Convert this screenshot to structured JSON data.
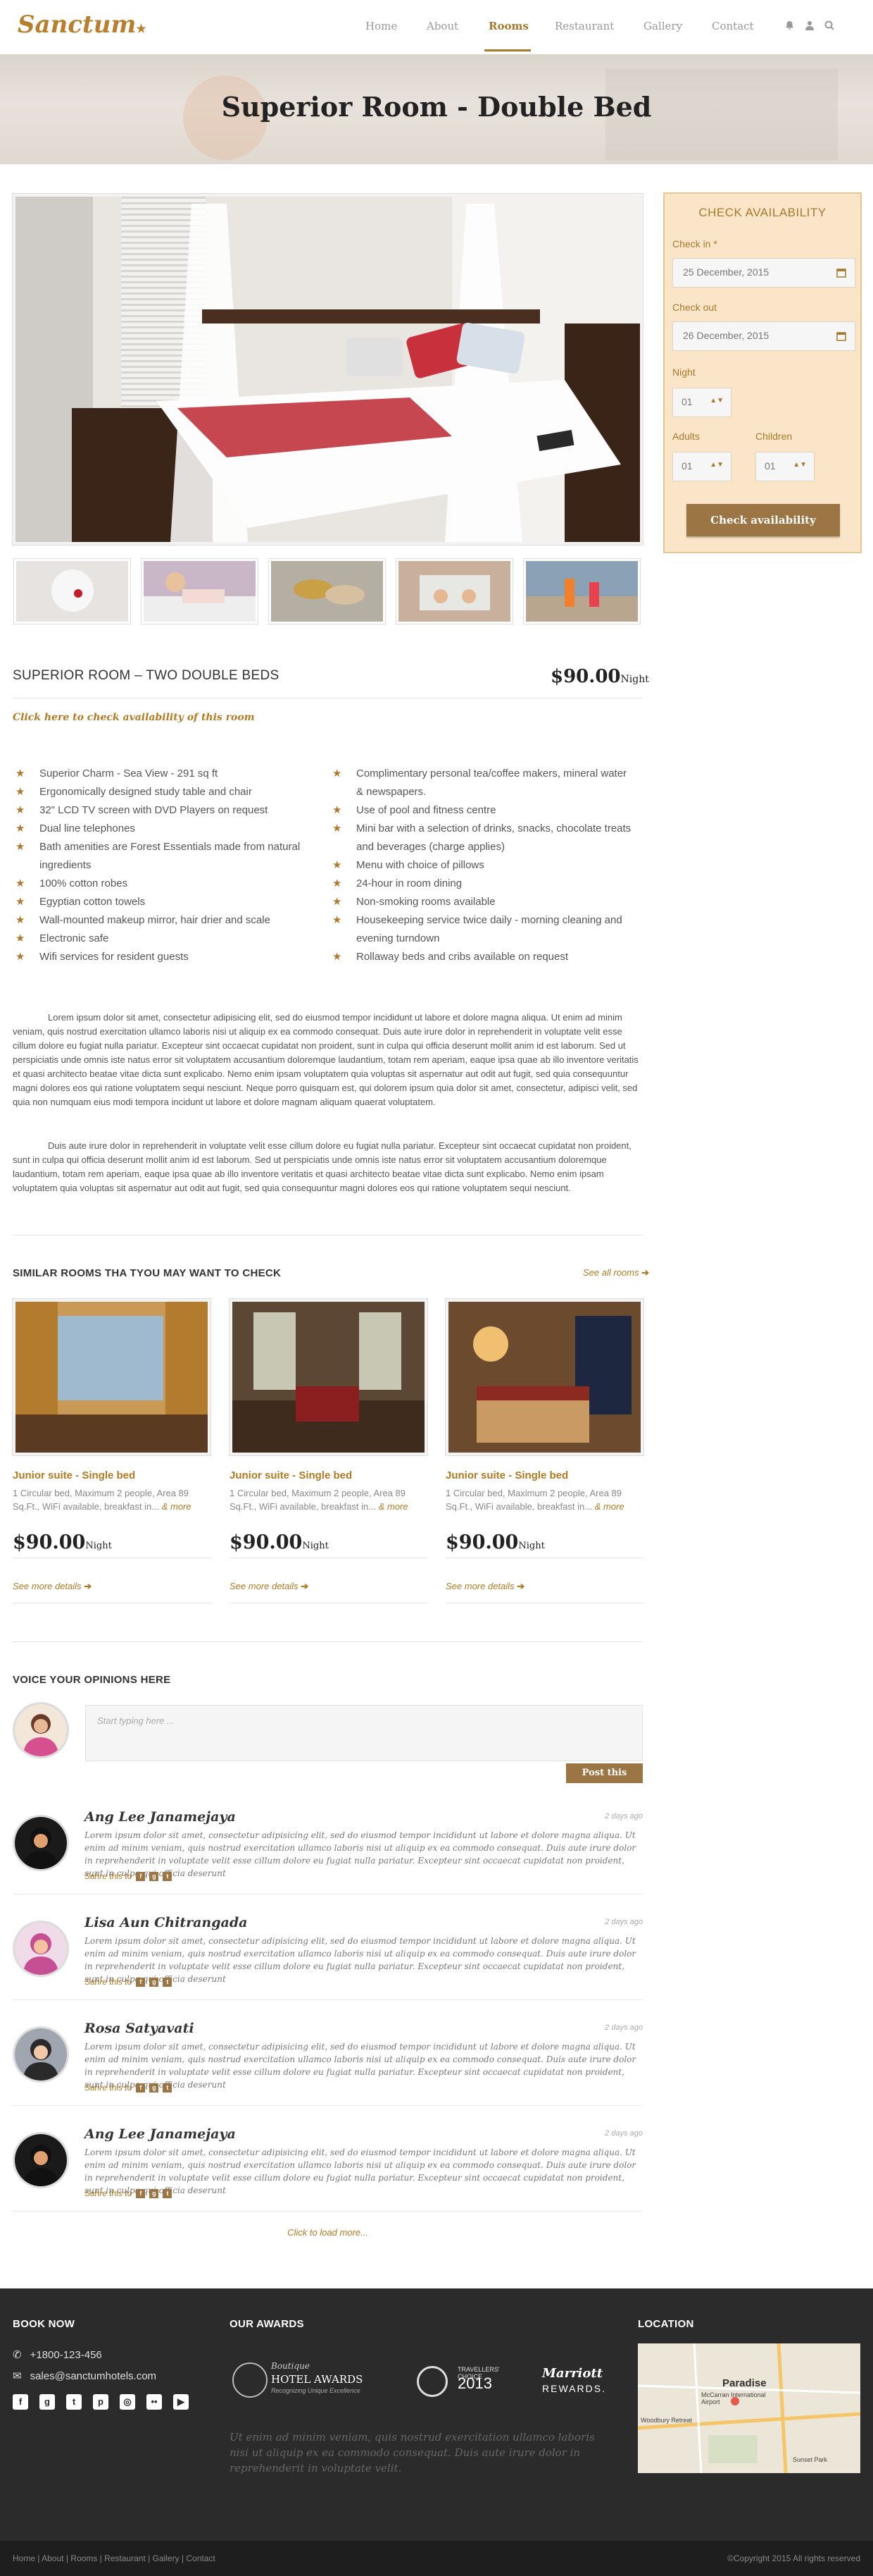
{
  "brand": {
    "logo": "Sanctum"
  },
  "nav": {
    "items": [
      "Home",
      "About",
      "Rooms",
      "Restaurant",
      "Gallery",
      "Contact"
    ],
    "active": "Rooms"
  },
  "hero": {
    "title": "Superior Room - Double Bed"
  },
  "booking": {
    "title": "CHECK AVAILABILITY",
    "checkin_label": "Check in *",
    "checkin_value": "25 December, 2015",
    "checkout_label": "Check out",
    "checkout_value": "26 December, 2015",
    "night_label": "Night",
    "night_value": "01",
    "adults_label": "Adults",
    "adults_value": "01",
    "children_label": "Children",
    "children_value": "01",
    "button": "Check availability"
  },
  "room": {
    "title": "SUPERIOR ROOM – TWO DOUBLE BEDS",
    "price": "$90.00",
    "price_unit": "Night",
    "check_link": "Click here to check availability of this room",
    "features_left": [
      "Superior Charm - Sea View - 291 sq ft",
      "Ergonomically designed study table and chair",
      "32\" LCD TV screen with DVD Players on request",
      "Dual line telephones",
      "Bath amenities are Forest Essentials made from natural",
      "ingredients",
      "100% cotton robes",
      "Egyptian cotton towels",
      "Wall-mounted makeup mirror, hair drier and scale",
      "Electronic safe",
      "Wifi services for resident guests"
    ],
    "features_right": [
      "Complimentary personal tea/coffee makers, mineral water",
      "& newspapers.",
      "Use of pool and fitness centre",
      "Mini bar with a selection of drinks, snacks, chocolate treats",
      "and beverages (charge applies)",
      "Menu with choice of pillows",
      "24-hour in room dining",
      "Non-smoking rooms available",
      "Housekeeping service twice daily - morning cleaning and",
      "evening turndown",
      "Rollaway beds and cribs available on request"
    ],
    "description_1": "Lorem ipsum dolor sit amet, consectetur adipisicing elit, sed do eiusmod tempor incididunt ut labore et dolore magna aliqua. Ut enim ad minim veniam, quis nostrud exercitation ullamco laboris nisi ut aliquip ex ea commodo consequat. Duis aute irure dolor in reprehenderit in voluptate velit esse cillum dolore eu fugiat nulla pariatur. Excepteur sint occaecat cupidatat non proident, sunt in culpa qui officia deserunt mollit anim id est laborum. Sed ut perspiciatis unde omnis iste natus error sit voluptatem accusantium doloremque laudantium, totam rem aperiam, eaque ipsa quae ab illo inventore veritatis et quasi architecto beatae vitae dicta sunt explicabo. Nemo enim ipsam voluptatem quia voluptas sit aspernatur aut odit aut fugit, sed quia consequuntur magni dolores eos qui ratione voluptatem sequi nesciunt. Neque porro quisquam est, qui dolorem ipsum quia dolor sit amet, consectetur, adipisci velit, sed quia non numquam eius modi tempora incidunt ut labore et dolore magnam aliquam quaerat voluptatem.",
    "description_2": "Duis aute irure dolor in reprehenderit in voluptate velit esse cillum dolore eu fugiat nulla pariatur. Excepteur sint occaecat cupidatat non proident, sunt in culpa qui officia deserunt mollit anim id est laborum. Sed ut perspiciatis unde omnis iste natus error sit voluptatem accusantium doloremque laudantium, totam rem aperiam, eaque ipsa quae ab illo inventore veritatis et quasi architecto beatae vitae dicta sunt explicabo. Nemo enim ipsam voluptatem quia voluptas sit aspernatur aut odit aut fugit, sed quia consequuntur magni dolores eos qui ratione voluptatem sequi nesciunt."
  },
  "similar": {
    "title": "SIMILAR ROOMS THA TYOU MAY WANT TO CHECK",
    "see_all": "See all rooms",
    "cards": [
      {
        "title": "Junior suite - Single bed",
        "desc": "1 Circular bed, Maximum 2 people, Area 89 Sq.Ft., WiFi available, breakfast in...",
        "more": "& more",
        "price": "$90.00",
        "unit": "Night",
        "link": "See more details"
      },
      {
        "title": "Junior suite - Single bed",
        "desc": "1 Circular bed, Maximum 2 people, Area 89 Sq.Ft., WiFi available, breakfast in...",
        "more": "& more",
        "price": "$90.00",
        "unit": "Night",
        "link": "See more details"
      },
      {
        "title": "Junior suite - Single bed",
        "desc": "1 Circular bed, Maximum 2 people, Area 89 Sq.Ft., WiFi available, breakfast in...",
        "more": "& more",
        "price": "$90.00",
        "unit": "Night",
        "link": "See more details"
      }
    ]
  },
  "opinions": {
    "title": "VOICE YOUR OPINIONS HERE",
    "placeholder": "Start typing here ...",
    "post_button": "Post this",
    "comments": [
      {
        "name": "Ang Lee Janamejaya",
        "date": "2 days ago",
        "text": "Lorem ipsum dolor sit amet, consectetur adipisicing elit, sed do eiusmod tempor incididunt ut labore et dolore magna aliqua. Ut enim ad minim veniam, quis nostrud exercitation ullamco laboris nisi ut aliquip ex ea commodo consequat. Duis aute irure dolor in reprehenderit in voluptate velit esse cillum dolore eu fugiat nulla pariatur. Excepteur sint occaecat cupidatat non proident, sunt in culpa qui officia deserunt",
        "share": "Sahre this to"
      },
      {
        "name": "Lisa Aun Chitrangada",
        "date": "2 days ago",
        "text": "Lorem ipsum dolor sit amet, consectetur adipisicing elit, sed do eiusmod tempor incididunt ut labore et dolore magna aliqua. Ut enim ad minim veniam, quis nostrud exercitation ullamco laboris nisi ut aliquip ex ea commodo consequat. Duis aute irure dolor in reprehenderit in voluptate velit esse cillum dolore eu fugiat nulla pariatur. Excepteur sint occaecat cupidatat non proident, sunt in culpa qui officia deserunt",
        "share": "Sahre this to"
      },
      {
        "name": "Rosa Satyavati",
        "date": "2 days ago",
        "text": "Lorem ipsum dolor sit amet, consectetur adipisicing elit, sed do eiusmod tempor incididunt ut labore et dolore magna aliqua. Ut enim ad minim veniam, quis nostrud exercitation ullamco laboris nisi ut aliquip ex ea commodo consequat. Duis aute irure dolor in reprehenderit in voluptate velit esse cillum dolore eu fugiat nulla pariatur. Excepteur sint occaecat cupidatat non proident, sunt in culpa qui officia deserunt",
        "share": "Sahre this to"
      },
      {
        "name": "Ang Lee Janamejaya",
        "date": "2 days ago",
        "text": "Lorem ipsum dolor sit amet, consectetur adipisicing elit, sed do eiusmod tempor incididunt ut labore et dolore magna aliqua. Ut enim ad minim veniam, quis nostrud exercitation ullamco laboris nisi ut aliquip ex ea commodo consequat. Duis aute irure dolor in reprehenderit in voluptate velit esse cillum dolore eu fugiat nulla pariatur. Excepteur sint occaecat cupidatat non proident, sunt in culpa qui officia deserunt",
        "share": "Sahre this to"
      }
    ],
    "load_more": "Click to load more..."
  },
  "footer": {
    "book_title": "BOOK NOW",
    "phone": "+1800-123-456",
    "email": "sales@sanctumhotels.com",
    "awards_title": "OUR AWARDS",
    "award_1": "HOTEL AWARDS",
    "award_1_sub": "Recognizing Unique Excellence",
    "award_1_top": "Boutique",
    "award_2_top": "TRAVELLERS' CHOICE",
    "award_2": "2013",
    "award_3": "Marriott",
    "award_3_sub": "REWARDS.",
    "text": "Ut enim ad minim veniam, quis nostrud exercitation ullamco laboris nisi ut aliquip ex ea commodo consequat. Duis aute irure dolor in reprehenderit in voluptate velit.",
    "location_title": "LOCATION",
    "map_label_1": "Paradise",
    "map_label_2": "McCarran International Airport",
    "map_label_3": "Woodbury Retreat",
    "map_label_4": "Sunset Park",
    "links": "Home | About | Rooms | Restaurant | Gallery | Contact",
    "copyright": "©Copyright 2015 All rights reserved"
  },
  "colors": {
    "accent": "#a57a2c",
    "button": "#9c7544",
    "booking_bg": "#fbe5c8",
    "footer_bg": "#2b2b2b"
  }
}
